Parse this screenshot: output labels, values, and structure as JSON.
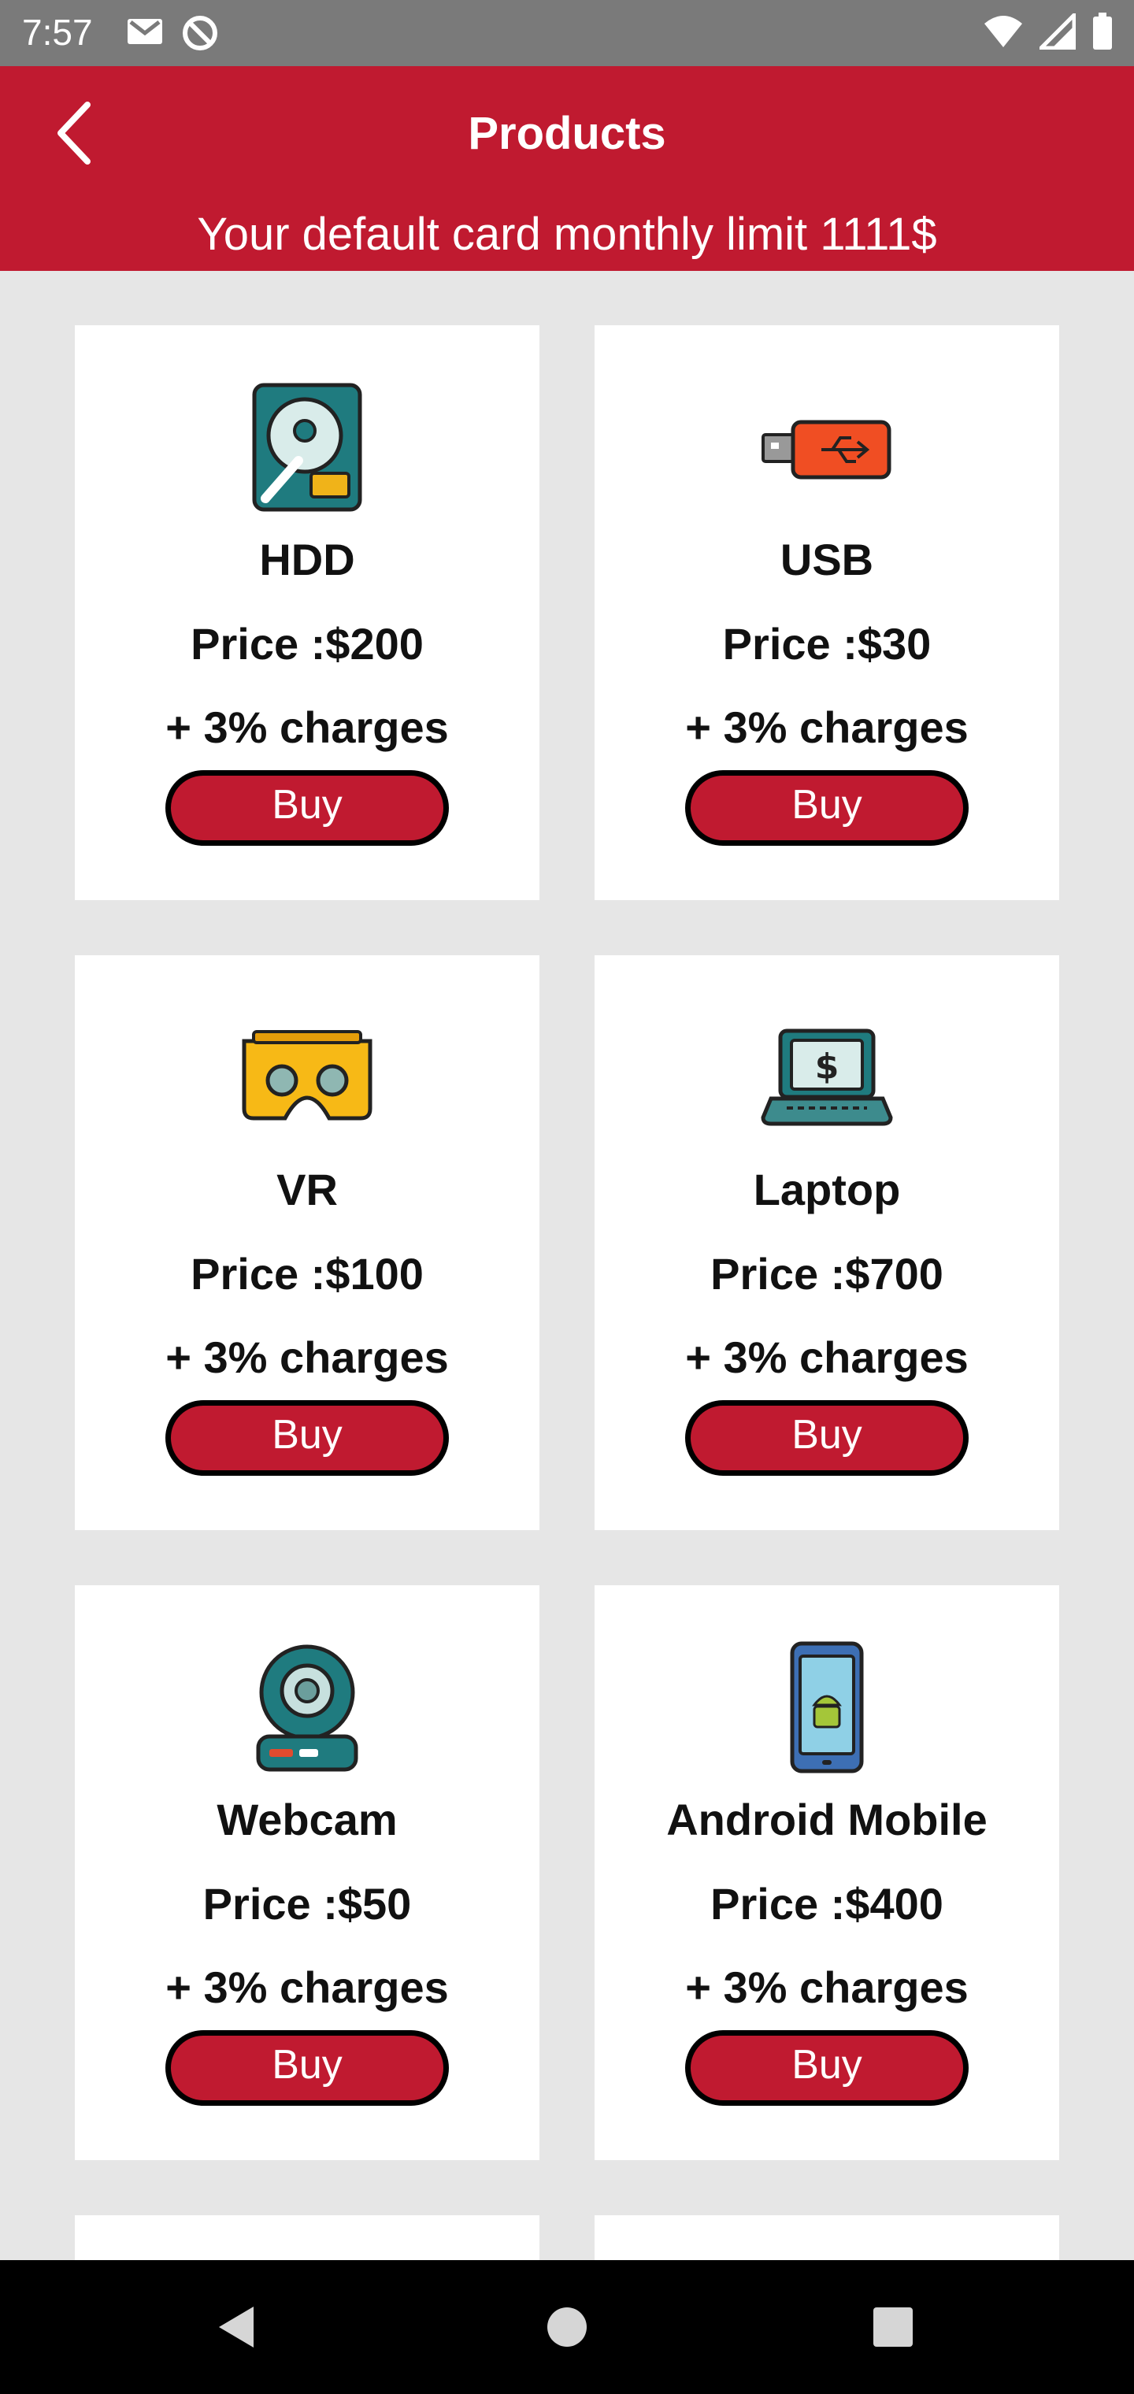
{
  "status_bar": {
    "time": "7:57",
    "left_icons": [
      "gmail-icon",
      "sync-disabled-icon"
    ],
    "right_icons": [
      "wifi-icon",
      "cell-signal-icon",
      "battery-icon"
    ]
  },
  "header": {
    "title": "Products",
    "back_icon": "chevron-left-icon",
    "limit_text": "Your default card monthly limit 1111$"
  },
  "colors": {
    "primary": "#c01a30",
    "background": "#e6e6e6",
    "card": "#ffffff"
  },
  "products": [
    {
      "name": "HDD",
      "price": "Price :$200",
      "charges": "+ 3% charges",
      "buy_label": "Buy",
      "icon": "hdd-icon"
    },
    {
      "name": "USB",
      "price": "Price :$30",
      "charges": "+ 3% charges",
      "buy_label": "Buy",
      "icon": "usb-icon"
    },
    {
      "name": "VR",
      "price": "Price :$100",
      "charges": "+ 3% charges",
      "buy_label": "Buy",
      "icon": "vr-headset-icon"
    },
    {
      "name": "Laptop",
      "price": "Price :$700",
      "charges": "+ 3% charges",
      "buy_label": "Buy",
      "icon": "laptop-icon"
    },
    {
      "name": "Webcam",
      "price": "Price :$50",
      "charges": "+ 3% charges",
      "buy_label": "Buy",
      "icon": "webcam-icon"
    },
    {
      "name": "Android Mobile",
      "price": "Price :$400",
      "charges": "+ 3% charges",
      "buy_label": "Buy",
      "icon": "android-phone-icon"
    }
  ],
  "nav_bar": {
    "buttons": [
      "back-triangle-icon",
      "home-circle-icon",
      "recents-square-icon"
    ]
  }
}
